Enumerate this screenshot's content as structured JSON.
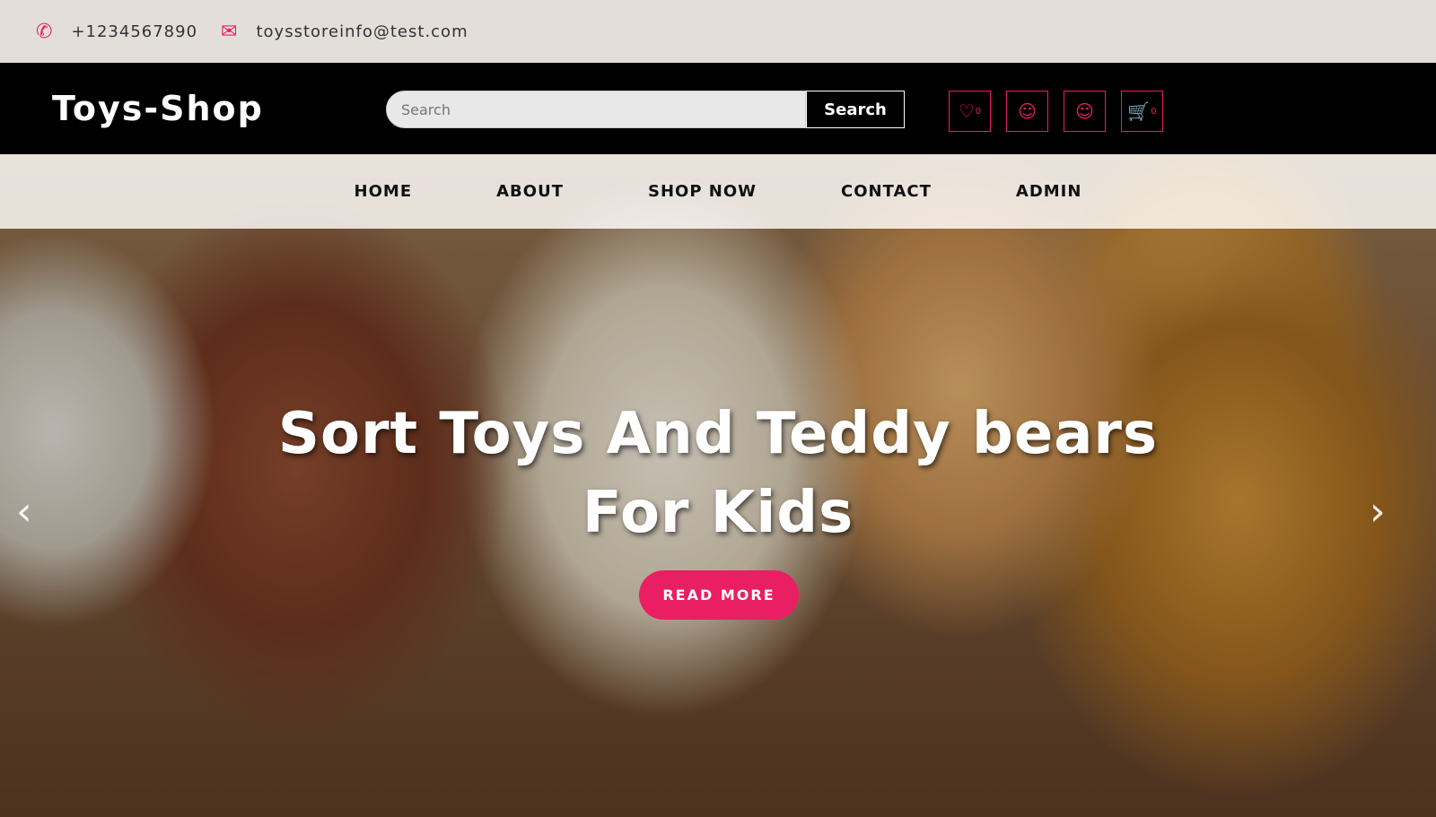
{
  "topbar": {
    "phone": "+1234567890",
    "email": "toysstoreinfo@test.com",
    "phone_icon": "phone-icon",
    "email_icon": "envelope-icon"
  },
  "header": {
    "logo": "Toys-Shop",
    "search_placeholder": "Search",
    "search_button": "Search",
    "wishlist_count": "0",
    "cart_count": "0"
  },
  "nav": [
    "HOME",
    "ABOUT",
    "SHOP NOW",
    "CONTACT",
    "ADMIN"
  ],
  "hero": {
    "line1": "Sort Toys And Teddy bears",
    "line2": "For Kids",
    "button": "READ MORE"
  },
  "colors": {
    "accent": "#e91e63",
    "header_bg": "#000000"
  }
}
